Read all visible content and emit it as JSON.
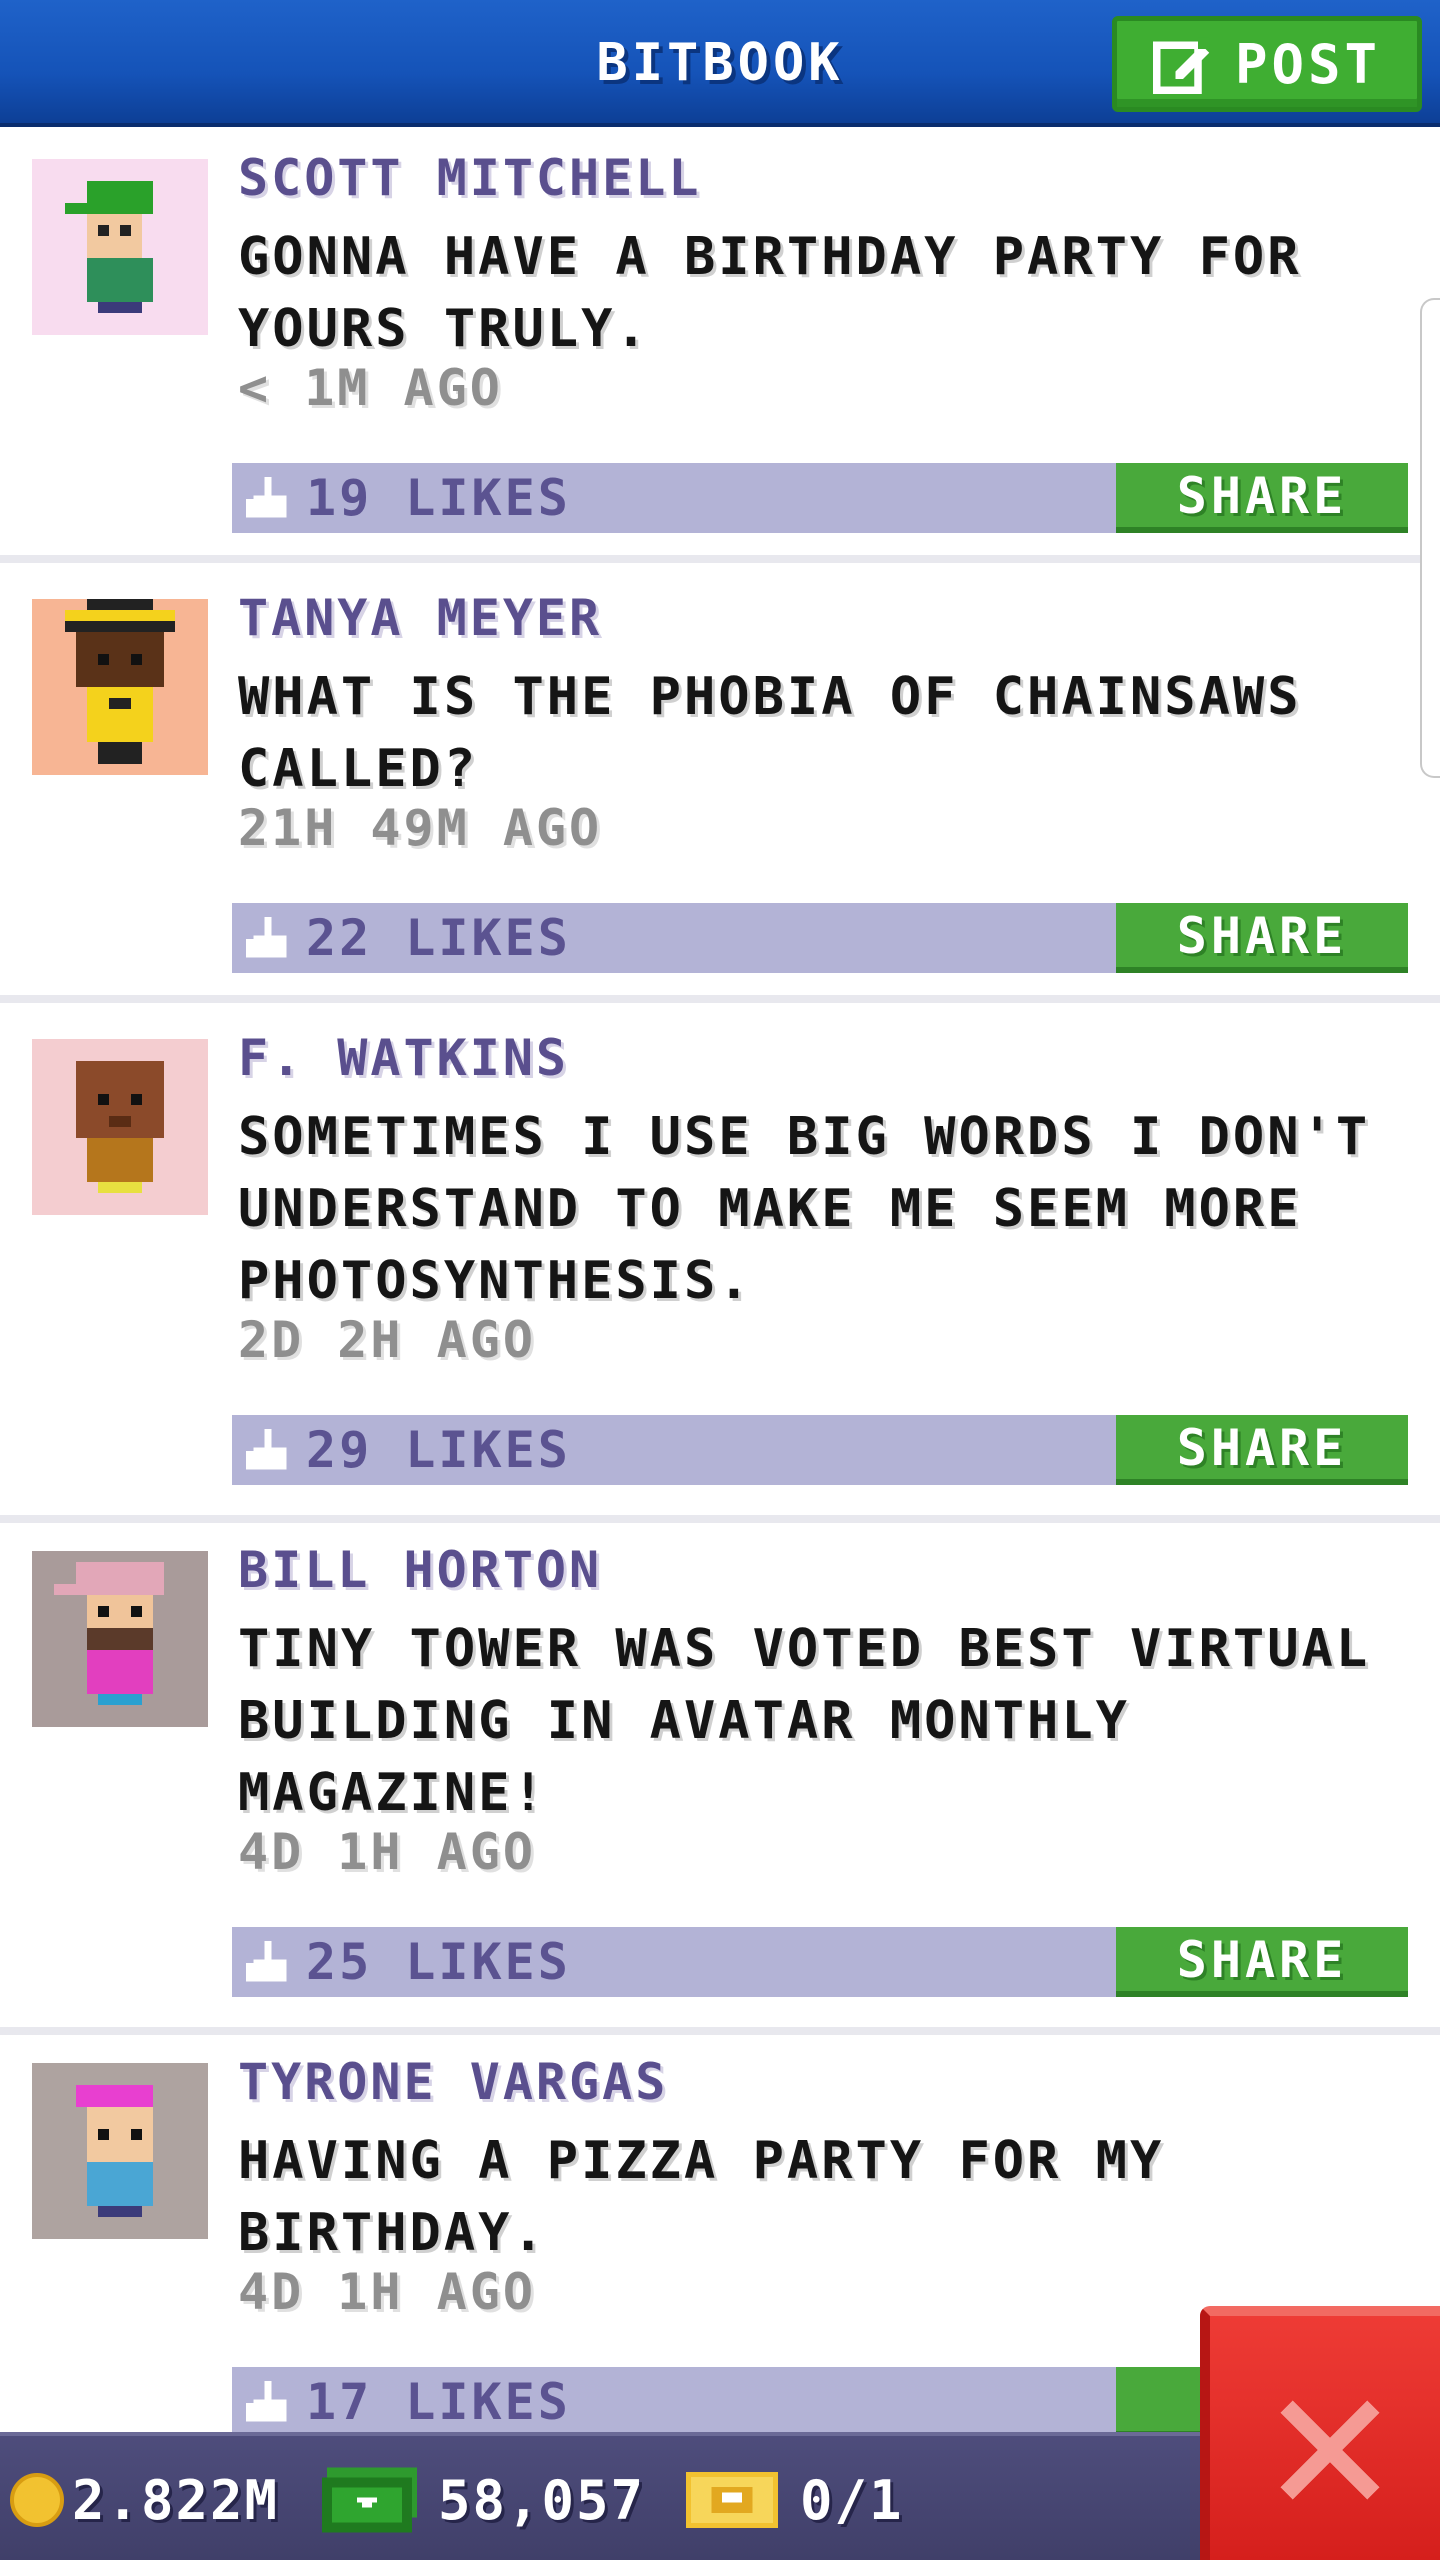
{
  "header": {
    "title": "BITBOOK",
    "post_label": "POST"
  },
  "posts": [
    {
      "author": "SCOTT MITCHELL",
      "message": "GONNA HAVE A BIRTHDAY PARTY FOR YOURS TRULY.",
      "time": "< 1M AGO",
      "likes": "19 LIKES",
      "share_label": "SHARE"
    },
    {
      "author": "TANYA MEYER",
      "message": "WHAT IS THE PHOBIA OF CHAINSAWS CALLED?",
      "time": "21H 49M AGO",
      "likes": "22 LIKES",
      "share_label": "SHARE"
    },
    {
      "author": "F. WATKINS",
      "message": "SOMETIMES I USE BIG WORDS I DON'T UNDERSTAND TO MAKE ME SEEM MORE PHOTOSYNTHESIS.",
      "time": "2D 2H AGO",
      "likes": "29 LIKES",
      "share_label": "SHARE"
    },
    {
      "author": "BILL HORTON",
      "message": "TINY TOWER WAS VOTED BEST VIRTUAL BUILDING IN AVATAR MONTHLY MAGAZINE!",
      "time": "4D 1H AGO",
      "likes": "25 LIKES",
      "share_label": "SHARE"
    },
    {
      "author": "TYRONE VARGAS",
      "message": "HAVING A PIZZA PARTY FOR MY BIRTHDAY.",
      "time": "4D 1H AGO",
      "likes": "17 LIKES",
      "share_label": "S"
    }
  ],
  "footer": {
    "coins": "2.822M",
    "bux": "58,057",
    "tickets": "0/1"
  },
  "icons": {
    "post": "edit-icon",
    "like": "thumbs-up-icon",
    "coin": "coin-icon",
    "bux": "bux-icon",
    "ticket": "ticket-icon",
    "close": "close-icon"
  },
  "colors": {
    "header": "#1553b8",
    "accent_green": "#49a93b",
    "like_bar": "#b3b3d6",
    "author": "#5a4f8e",
    "close": "#d51f1c",
    "footer": "#403f69"
  }
}
